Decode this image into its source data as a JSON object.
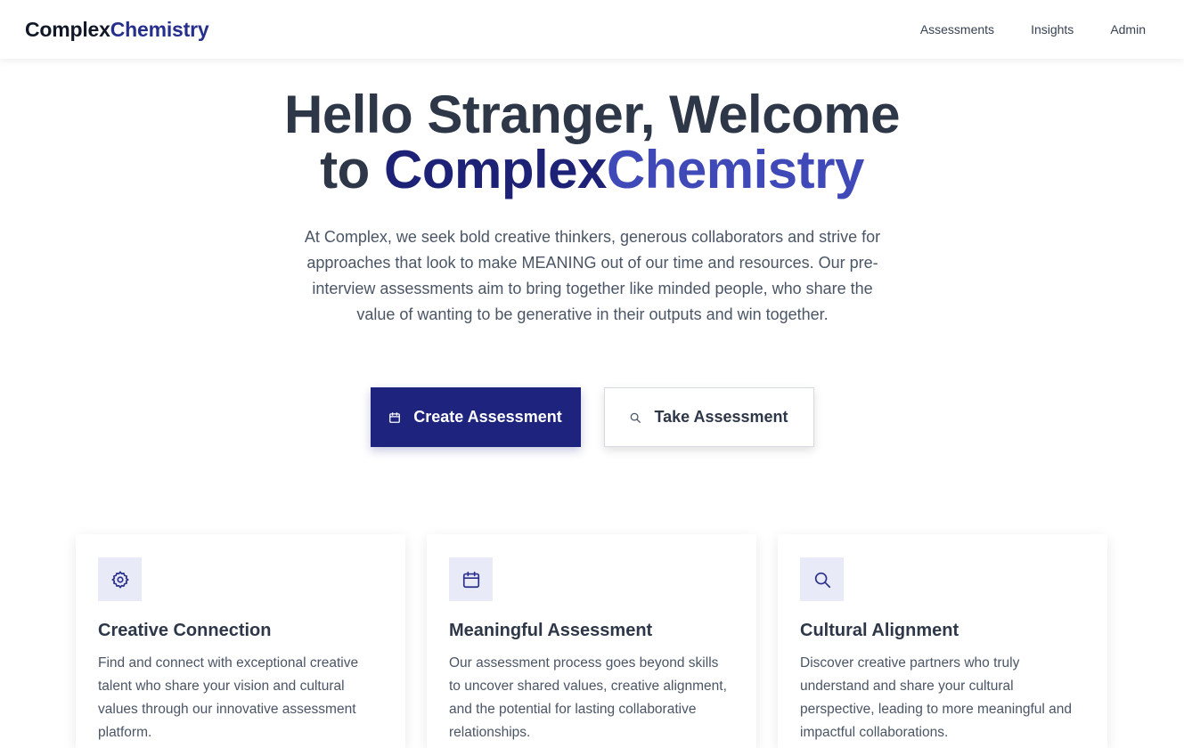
{
  "header": {
    "brand_part1": "Complex",
    "brand_part2": "Chemistry",
    "nav": [
      "Assessments",
      "Insights",
      "Admin"
    ]
  },
  "hero": {
    "title_line1": "Hello Stranger, Welcome",
    "title_to": "to",
    "title_brand1": "Complex",
    "title_brand2": "Chemistry",
    "description": "At Complex, we seek bold creative thinkers, generous collaborators and strive for approaches that look to make MEANING out of our time and resources. Our pre-interview assessments aim to bring together like minded people, who share the value of wanting to be generative in their outputs and win together."
  },
  "actions": {
    "create_label": "Create Assessment",
    "create_icon": "calendar-icon",
    "take_label": "Take Assessment",
    "take_icon": "search-icon"
  },
  "features": [
    {
      "icon": "gear-icon",
      "title": "Creative Connection",
      "text": "Find and connect with exceptional creative talent who share your vision and cultural values through our innovative assessment platform."
    },
    {
      "icon": "calendar-icon",
      "title": "Meaningful Assessment",
      "text": "Our assessment process goes beyond skills to uncover shared values, creative alignment, and the potential for lasting collaborative relationships."
    },
    {
      "icon": "search-icon",
      "title": "Cultural Alignment",
      "text": "Discover creative partners who truly understand and share your cultural perspective, leading to more meaningful and impactful collaborations."
    }
  ],
  "colors": {
    "brand_dark": "#1e237e",
    "brand_accent": "#3f49b8",
    "icon_bg": "#e8eaf7"
  }
}
